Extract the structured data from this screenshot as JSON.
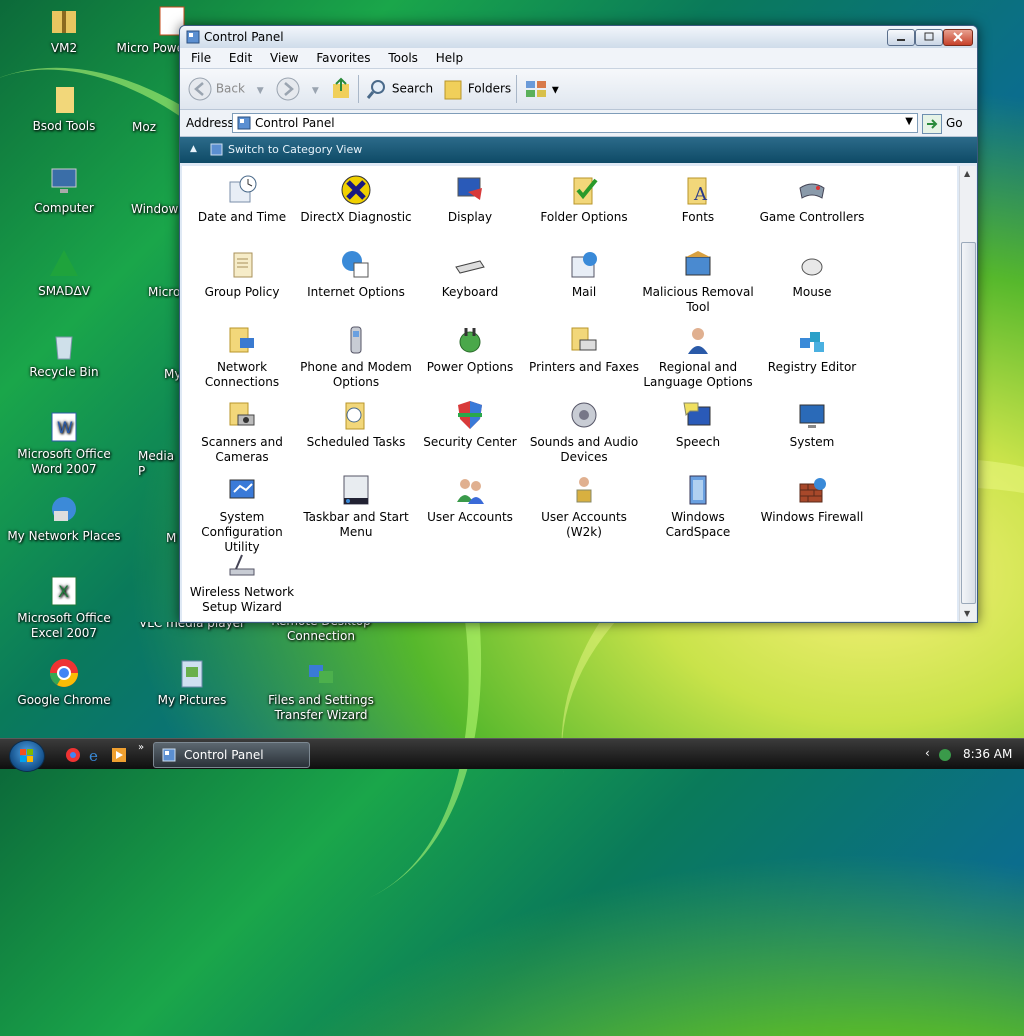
{
  "desktop": {
    "icons": [
      {
        "label": "VM2"
      },
      {
        "label": "Bsod Tools"
      },
      {
        "label": "Computer"
      },
      {
        "label": "SMADΔV"
      },
      {
        "label": "Recycle Bin"
      },
      {
        "label": "Microsoft Office Word 2007"
      },
      {
        "label": "My Network Places"
      },
      {
        "label": "Microsoft Office Excel 2007"
      },
      {
        "label": "Google Chrome"
      },
      {
        "label": "Micro Powe"
      },
      {
        "label": "Moz"
      },
      {
        "label": "Windows"
      },
      {
        "label": "Micro"
      },
      {
        "label": "My"
      },
      {
        "label": "Media P"
      },
      {
        "label": "M"
      },
      {
        "label": "VLC media player"
      },
      {
        "label": "Remote Desktop Connection"
      },
      {
        "label": "My Pictures"
      },
      {
        "label": "Files and Settings Transfer Wizard"
      }
    ]
  },
  "window": {
    "title": "Control Panel",
    "menu": [
      "File",
      "Edit",
      "View",
      "Favorites",
      "Tools",
      "Help"
    ],
    "toolbar": {
      "back": "Back",
      "search": "Search",
      "folders": "Folders"
    },
    "address": {
      "label": "Address",
      "value": "Control Panel",
      "go": "Go"
    },
    "category_link": "Switch to Category View",
    "items": [
      {
        "label": "Date and Time"
      },
      {
        "label": "DirectX Diagnostic"
      },
      {
        "label": "Display"
      },
      {
        "label": "Folder Options"
      },
      {
        "label": "Fonts"
      },
      {
        "label": "Game Controllers"
      },
      {
        "label": "Group Policy"
      },
      {
        "label": "Internet Options"
      },
      {
        "label": "Keyboard"
      },
      {
        "label": "Mail"
      },
      {
        "label": "Malicious Removal Tool"
      },
      {
        "label": "Mouse"
      },
      {
        "label": "Network Connections"
      },
      {
        "label": "Phone and Modem Options"
      },
      {
        "label": "Power Options"
      },
      {
        "label": "Printers and Faxes"
      },
      {
        "label": "Regional and Language Options"
      },
      {
        "label": "Registry Editor"
      },
      {
        "label": "Scanners and Cameras"
      },
      {
        "label": "Scheduled Tasks"
      },
      {
        "label": "Security Center"
      },
      {
        "label": "Sounds and Audio Devices"
      },
      {
        "label": "Speech"
      },
      {
        "label": "System"
      },
      {
        "label": "System Configuration Utility"
      },
      {
        "label": "Taskbar and Start Menu"
      },
      {
        "label": "User Accounts"
      },
      {
        "label": "User Accounts (W2k)"
      },
      {
        "label": "Windows CardSpace"
      },
      {
        "label": "Windows Firewall"
      },
      {
        "label": "Wireless Network Setup Wizard"
      }
    ]
  },
  "taskbar": {
    "task_label": "Control Panel",
    "clock": "8:36 AM"
  }
}
